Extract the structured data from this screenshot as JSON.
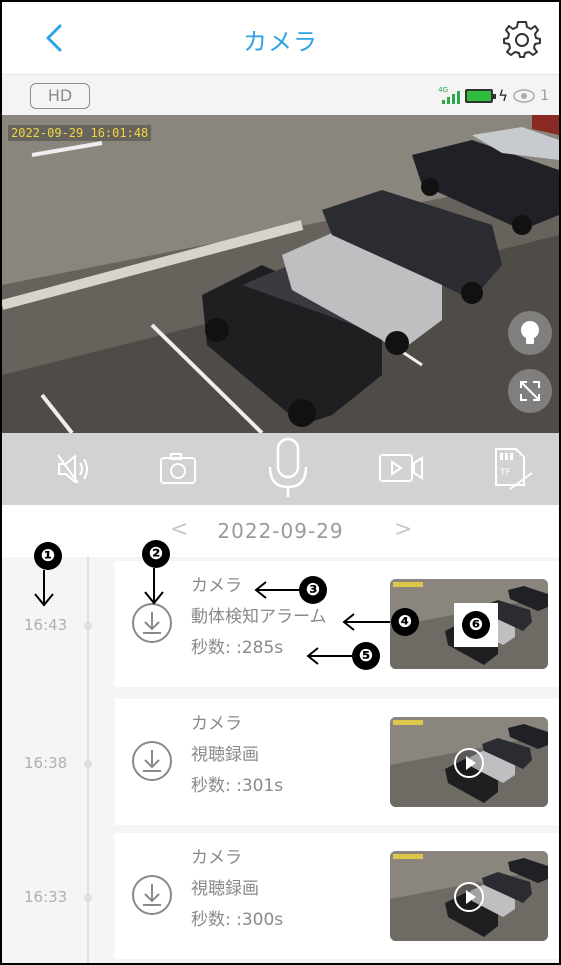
{
  "header": {
    "title": "カメラ",
    "back_icon": "chevron-left-icon",
    "settings_icon": "gear-icon",
    "accent_color": "#2ea2e6"
  },
  "status_bar": {
    "quality_label": "HD",
    "network_tag": "4G",
    "viewer_count": "1"
  },
  "video": {
    "timestamp": "2022-09-29 16:01:48"
  },
  "controls": [
    {
      "name": "mute-button",
      "icon": "speaker-mute-icon"
    },
    {
      "name": "snapshot-button",
      "icon": "camera-icon"
    },
    {
      "name": "talk-button",
      "icon": "microphone-icon"
    },
    {
      "name": "record-button",
      "icon": "video-record-icon"
    },
    {
      "name": "tf-card-button",
      "icon": "tf-card-disabled-icon"
    }
  ],
  "date_selector": {
    "date": "2022-09-29",
    "prev": "<",
    "next": ">"
  },
  "recordings": [
    {
      "time": "16:43",
      "device": "カメラ",
      "type": "動体検知アラーム",
      "duration": "秒数: :285s",
      "has_play": false
    },
    {
      "time": "16:38",
      "device": "カメラ",
      "type": "視聴録画",
      "duration": "秒数: :301s",
      "has_play": true
    },
    {
      "time": "16:33",
      "device": "カメラ",
      "type": "視聴録画",
      "duration": "秒数: :300s",
      "has_play": true
    }
  ],
  "annotations": [
    "❶",
    "❷",
    "❸",
    "❹",
    "❺",
    "❻"
  ]
}
